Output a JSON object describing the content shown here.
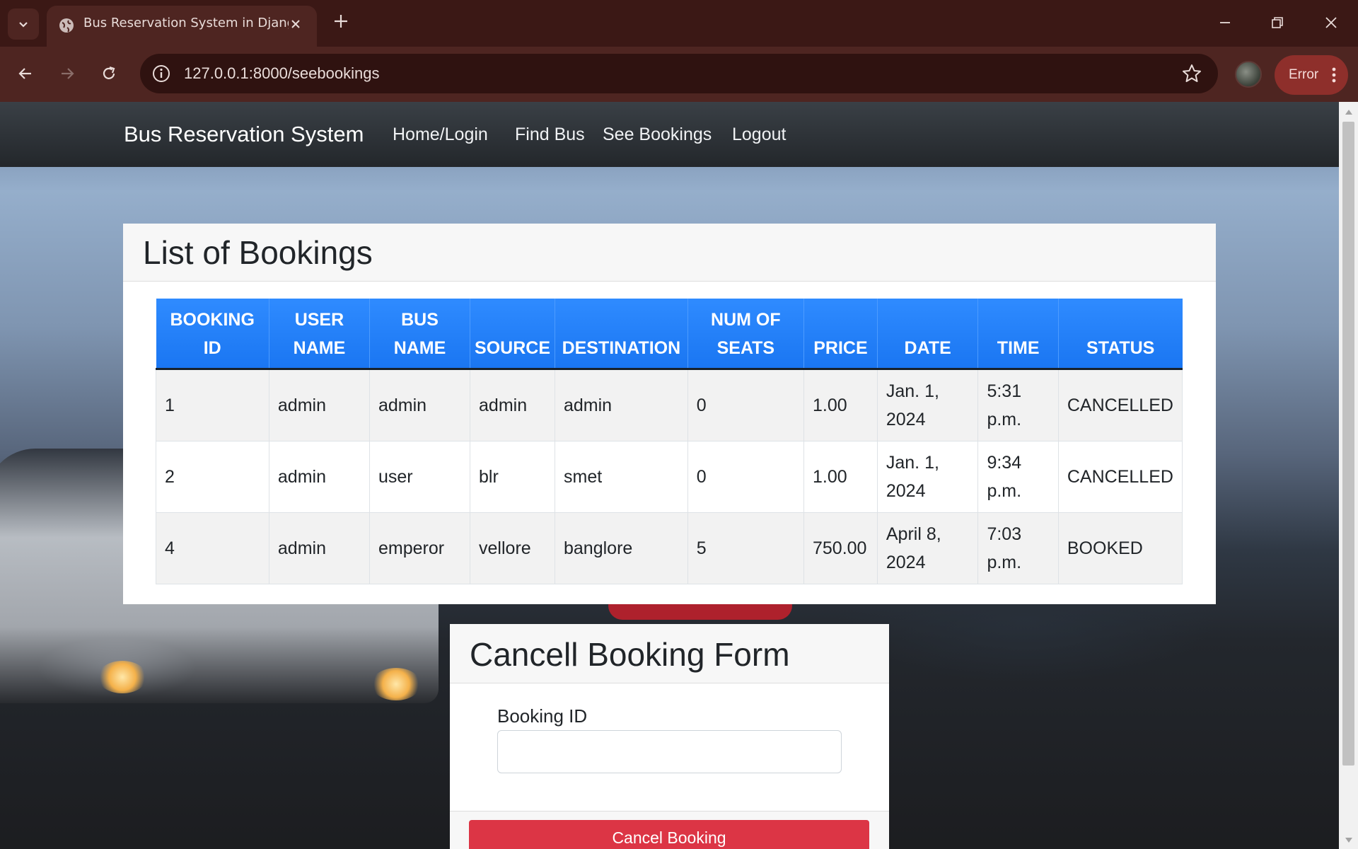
{
  "browser": {
    "tab_title": "Bus Reservation System in Django",
    "url": "127.0.0.1:8000/seebookings",
    "error_label": "Error"
  },
  "navbar": {
    "brand": "Bus Reservation System",
    "links": [
      "Home/Login",
      "Find Bus",
      "See Bookings",
      "Logout"
    ]
  },
  "bookings": {
    "title": "List of Bookings",
    "columns": [
      [
        "BOOKING",
        "ID"
      ],
      [
        "USER",
        "NAME"
      ],
      [
        "BUS",
        "NAME"
      ],
      [
        "SOURCE"
      ],
      [
        "DESTINATION"
      ],
      [
        "NUM OF",
        "SEATS"
      ],
      [
        "PRICE"
      ],
      [
        "DATE"
      ],
      [
        "TIME"
      ],
      [
        "STATUS"
      ]
    ],
    "rows": [
      {
        "id": "1",
        "user": "admin",
        "bus": "admin",
        "source": "admin",
        "destination": "admin",
        "seats": "0",
        "price": "1.00",
        "date": [
          "Jan. 1,",
          "2024"
        ],
        "time": [
          "5:31",
          "p.m."
        ],
        "status": "CANCELLED"
      },
      {
        "id": "2",
        "user": "admin",
        "bus": "user",
        "source": "blr",
        "destination": "smet",
        "seats": "0",
        "price": "1.00",
        "date": [
          "Jan. 1,",
          "2024"
        ],
        "time": [
          "9:34",
          "p.m."
        ],
        "status": "CANCELLED"
      },
      {
        "id": "4",
        "user": "admin",
        "bus": "emperor",
        "source": "vellore",
        "destination": "banglore",
        "seats": "5",
        "price": "750.00",
        "date": [
          "April 8,",
          "2024"
        ],
        "time": [
          "7:03",
          "p.m."
        ],
        "status": "BOOKED"
      }
    ]
  },
  "cancel_form": {
    "title": "Cancell Booking Form",
    "field_label": "Booking ID",
    "field_value": "",
    "button_label": "Cancel Booking"
  }
}
